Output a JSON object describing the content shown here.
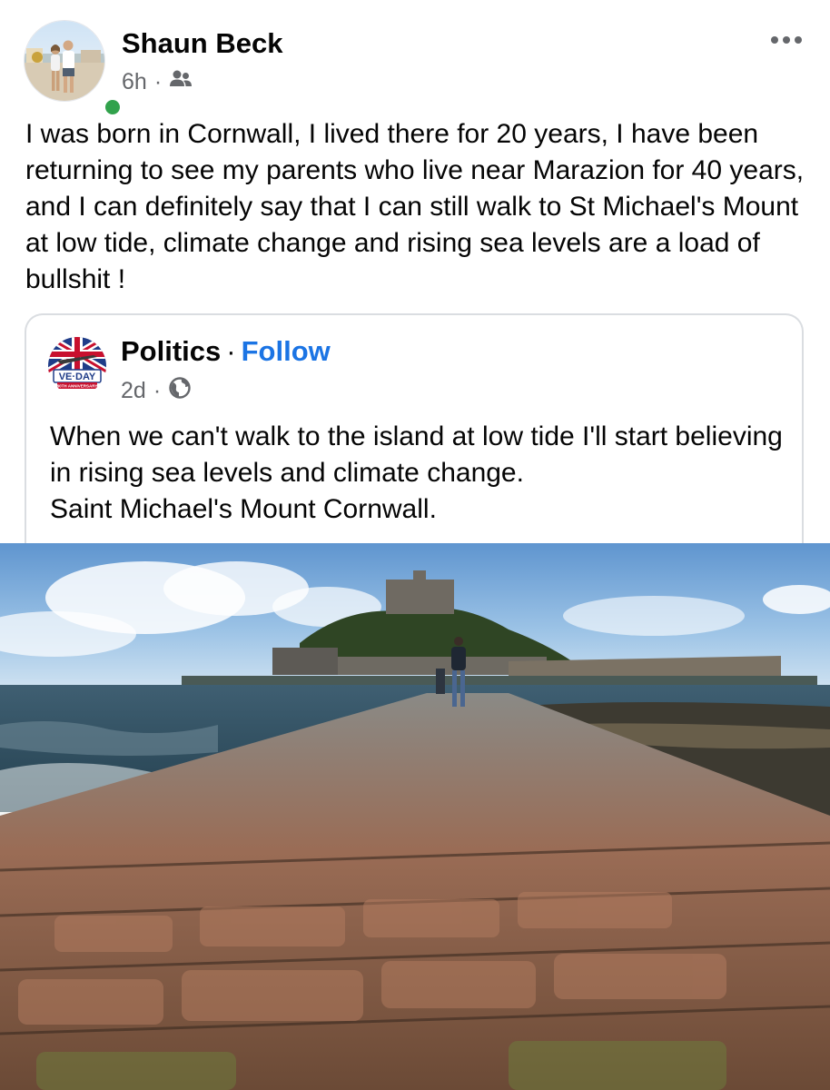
{
  "post": {
    "author": "Shaun Beck",
    "time": "6h",
    "separator": "·",
    "audience_icon": "friends-icon",
    "more_icon": "more-options-icon",
    "text": "I was born in Cornwall, I lived there for 20 years, I have been returning to see my parents who live near Marazion for 40 years, and I can definitely say that I can still walk to St Michael's Mount at low tide, climate change and rising sea levels are a load of bullshit  !"
  },
  "shared": {
    "page_name": "Politics",
    "separator": "·",
    "follow_label": "Follow",
    "time": "2d",
    "audience_icon": "globe-icon",
    "avatar_text": "VE·DAY",
    "avatar_subtext": "80TH ANNIVERSARY",
    "text": "When we can't walk to the island at low tide I'll start believing in rising sea levels and climate change.\nSaint Michael's Mount Cornwall."
  },
  "colors": {
    "link": "#1b74e4",
    "online": "#31a24c",
    "secondary_text": "#65676b"
  }
}
